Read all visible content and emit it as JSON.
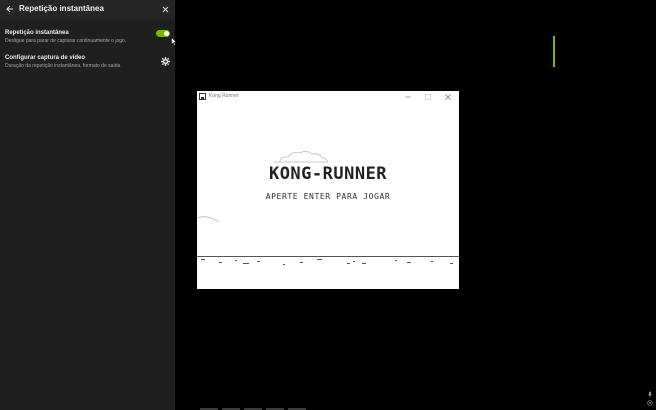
{
  "panel": {
    "title": "Repetição instantânea",
    "settings": [
      {
        "title": "Repetição instantânea",
        "description": "Desligue para parar de capturar continuamente o jogo.",
        "toggle_on": true
      },
      {
        "title": "Configurar captura de vídeo",
        "description": "Duração da repetição instantânea, formato de saída"
      }
    ]
  },
  "game_window": {
    "title": "Kong Runner",
    "game_title": "KONG-RUNNER",
    "prompt": "APERTE ENTER PARA JOGAR"
  },
  "colors": {
    "accent": "#76b900",
    "panel_bg": "#1f1f1f",
    "header_bg": "#262626"
  },
  "icons": {
    "back": "arrow-left-icon",
    "close": "close-icon",
    "settings": "gear-icon"
  }
}
